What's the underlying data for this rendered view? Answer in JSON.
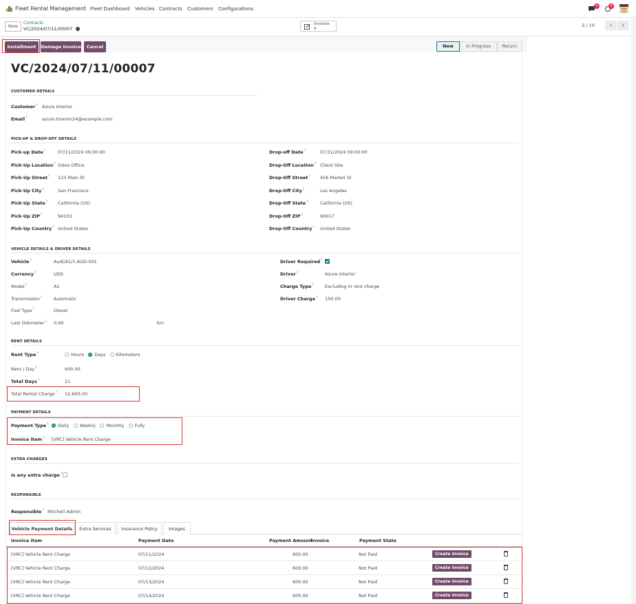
{
  "topbar": {
    "app_name": "Fleet Rental Management",
    "menu": [
      "Fleet Dashboard",
      "Vehicles",
      "Contracts",
      "Customers",
      "Configurations"
    ],
    "chat_count": "9",
    "activity_count": "4"
  },
  "control": {
    "new_label": "New",
    "breadcrumb_parent": "Contracts",
    "breadcrumb_current": "VC/2024/07/11/00007",
    "smart_button_label": "Invoices",
    "smart_button_count": "0",
    "pager": "3 / 10"
  },
  "actions": {
    "installment": "Installment",
    "damage_invoice": "Damage Invoice",
    "cancel": "Cancel"
  },
  "statusbar": [
    "New",
    "In Progress",
    "Return"
  ],
  "record_title": "VC/2024/07/11/00007",
  "customer": {
    "section": "CUSTOMER DETAILS",
    "customer_label": "Customer",
    "customer_value": "Azure Interior",
    "email_label": "Email",
    "email_value": "azure.Interior24@example.com"
  },
  "pickup": {
    "section": "PICK-UP & DROP-OFF DETAILS",
    "left": [
      {
        "label": "Pick-up Date",
        "value": "07/11/2024 09:00:00"
      },
      {
        "label": "Pick-Up Location",
        "value": "Odoo Office"
      },
      {
        "label": "Pick-Up Street",
        "value": "123 Main St"
      },
      {
        "label": "Pick-Up City",
        "value": "San Francisco"
      },
      {
        "label": "Pick-Up State",
        "value": "California (US)"
      },
      {
        "label": "Pick-Up ZIP",
        "value": "94103"
      },
      {
        "label": "Pick-Up Country",
        "value": "United States"
      }
    ],
    "right": [
      {
        "label": "Drop-off Date",
        "value": "07/31/2024 09:00:00"
      },
      {
        "label": "Drop-Off Location",
        "value": "Client Site"
      },
      {
        "label": "Drop-Off Street",
        "value": "456 Market St"
      },
      {
        "label": "Drop-Off City",
        "value": "Los Angeles"
      },
      {
        "label": "Drop-Off State",
        "value": "California (US)"
      },
      {
        "label": "Drop-Off ZIP",
        "value": "90017"
      },
      {
        "label": "Drop-Off Country",
        "value": "United States"
      }
    ]
  },
  "vehicle": {
    "section": "VEHICLE DETAILS & DRIVER DETAILS",
    "left": [
      {
        "label": "Vehicle",
        "value": "Audi/A1/1-AUD-001"
      },
      {
        "label": "Currency",
        "value": "USD"
      },
      {
        "label": "Model",
        "value": "A1"
      },
      {
        "label": "Transmission",
        "value": "Automatic"
      },
      {
        "label": "Fuel Type",
        "value": "Diesel"
      },
      {
        "label": "Last Odometer",
        "value": "0.00"
      }
    ],
    "odometer_unit": "km",
    "right": [
      {
        "label": "Driver Required",
        "value": ""
      },
      {
        "label": "Driver",
        "value": "Azure Interior"
      },
      {
        "label": "Charge Type",
        "value": "Excluding in rent charge"
      },
      {
        "label": "Driver Charge",
        "value": "150.00"
      }
    ]
  },
  "rent": {
    "section": "RENT DETAILS",
    "rent_type_label": "Rent Type",
    "rent_type_options": [
      "Hours",
      "Days",
      "Kilometers"
    ],
    "rent_type_selected": "Days",
    "rent_day_label": "Rent / Day",
    "rent_day_value": "600.00",
    "total_days_label": "Total Days",
    "total_days_value": "21",
    "total_charge_label": "Total Rental Charge",
    "total_charge_value": "12,600.00"
  },
  "payment": {
    "section": "PAYMENT DETAILS",
    "payment_type_label": "Payment Type",
    "payment_type_options": [
      "Daily",
      "Weekly",
      "Monthly",
      "Fully"
    ],
    "payment_type_selected": "Daily",
    "invoice_item_label": "Invoice Item",
    "invoice_item_value": "[VRC] Vehicle Rent Charge"
  },
  "extra": {
    "section": "EXTRA CHARGES",
    "label": "Is any extra charge"
  },
  "responsible": {
    "section": "RESPONSIBLE",
    "label": "Responsible",
    "value": "Mitchell Admin"
  },
  "tabs": [
    "Vehicle Payment Details",
    "Extra Services",
    "Insurance Policy",
    "Images"
  ],
  "table": {
    "headers": [
      "Invoice Item",
      "Payment Date",
      "Payment Amount",
      "Invoice",
      "Payment State"
    ],
    "rows": [
      {
        "item": "[VRC] Vehicle Rent Charge",
        "date": "07/11/2024",
        "amount": "600.00",
        "state": "Not Paid",
        "action": "Create Invoice"
      },
      {
        "item": "[VRC] Vehicle Rent Charge",
        "date": "07/12/2024",
        "amount": "600.00",
        "state": "Not Paid",
        "action": "Create Invoice"
      },
      {
        "item": "[VRC] Vehicle Rent Charge",
        "date": "07/13/2024",
        "amount": "600.00",
        "state": "Not Paid",
        "action": "Create Invoice"
      },
      {
        "item": "[VRC] Vehicle Rent Charge",
        "date": "07/14/2024",
        "amount": "600.00",
        "state": "Not Paid",
        "action": "Create Invoice"
      }
    ]
  }
}
